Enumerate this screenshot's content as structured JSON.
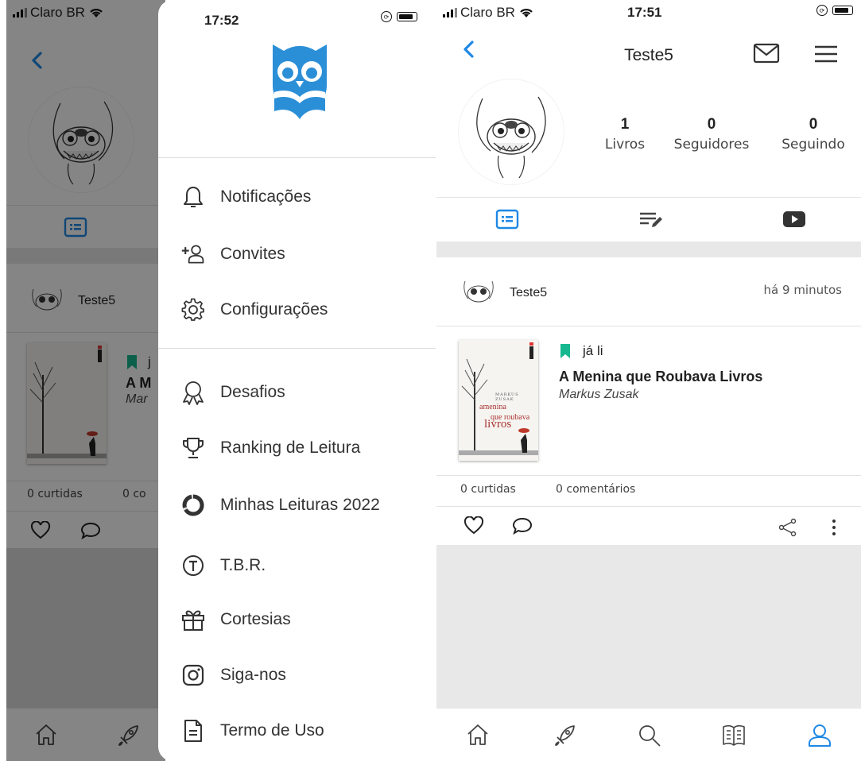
{
  "status_left": {
    "carrier": "Claro BR",
    "time": "17:52"
  },
  "status_right": {
    "carrier": "Claro BR",
    "time": "17:51"
  },
  "profile": {
    "username": "Teste5",
    "stats": [
      {
        "value": "1",
        "label": "Livros"
      },
      {
        "value": "0",
        "label": "Seguidores"
      },
      {
        "value": "0",
        "label": "Seguindo"
      }
    ]
  },
  "post": {
    "author": "Teste5",
    "time_ago": "há 9 minutos",
    "status": "já li",
    "book_title": "A Menina que Roubava Livros",
    "book_author": "Markus Zusak",
    "likes_count": "0",
    "likes_label": "curtidas",
    "comments_count": "0",
    "comments_label": "comentários",
    "status_color": "#17b890"
  },
  "left_post": {
    "author": "Teste5",
    "status_initial": "j",
    "book_title_partial": "A M",
    "book_author_partial": "Mar",
    "likes": "0  curtidas",
    "comments_partial": "0  co"
  },
  "cover": {
    "author": "MARKUS ZUSAK",
    "title_1": "a",
    "title_2": "menina",
    "title_3": "que roubava",
    "title_4": "livros"
  },
  "drawer": {
    "items_group1": [
      {
        "label": "Notificações",
        "icon": "bell-icon"
      },
      {
        "label": "Convites",
        "icon": "add-user-icon"
      },
      {
        "label": "Configurações",
        "icon": "gear-icon"
      }
    ],
    "items_group2": [
      {
        "label": "Desafios",
        "icon": "award-icon"
      },
      {
        "label": "Ranking de Leitura",
        "icon": "trophy-icon"
      },
      {
        "label": "Minhas Leituras 2022",
        "icon": "progress-ring-icon"
      },
      {
        "label": "T.B.R.",
        "icon": "t-circle-icon"
      },
      {
        "label": "Cortesias",
        "icon": "gift-icon"
      },
      {
        "label": "Siga-nos",
        "icon": "instagram-icon"
      },
      {
        "label": "Termo de Uso",
        "icon": "document-icon"
      }
    ]
  },
  "colors": {
    "accent": "#1e88e5",
    "logo": "#2b8fd8",
    "gray_band": "#e8e8e8"
  }
}
